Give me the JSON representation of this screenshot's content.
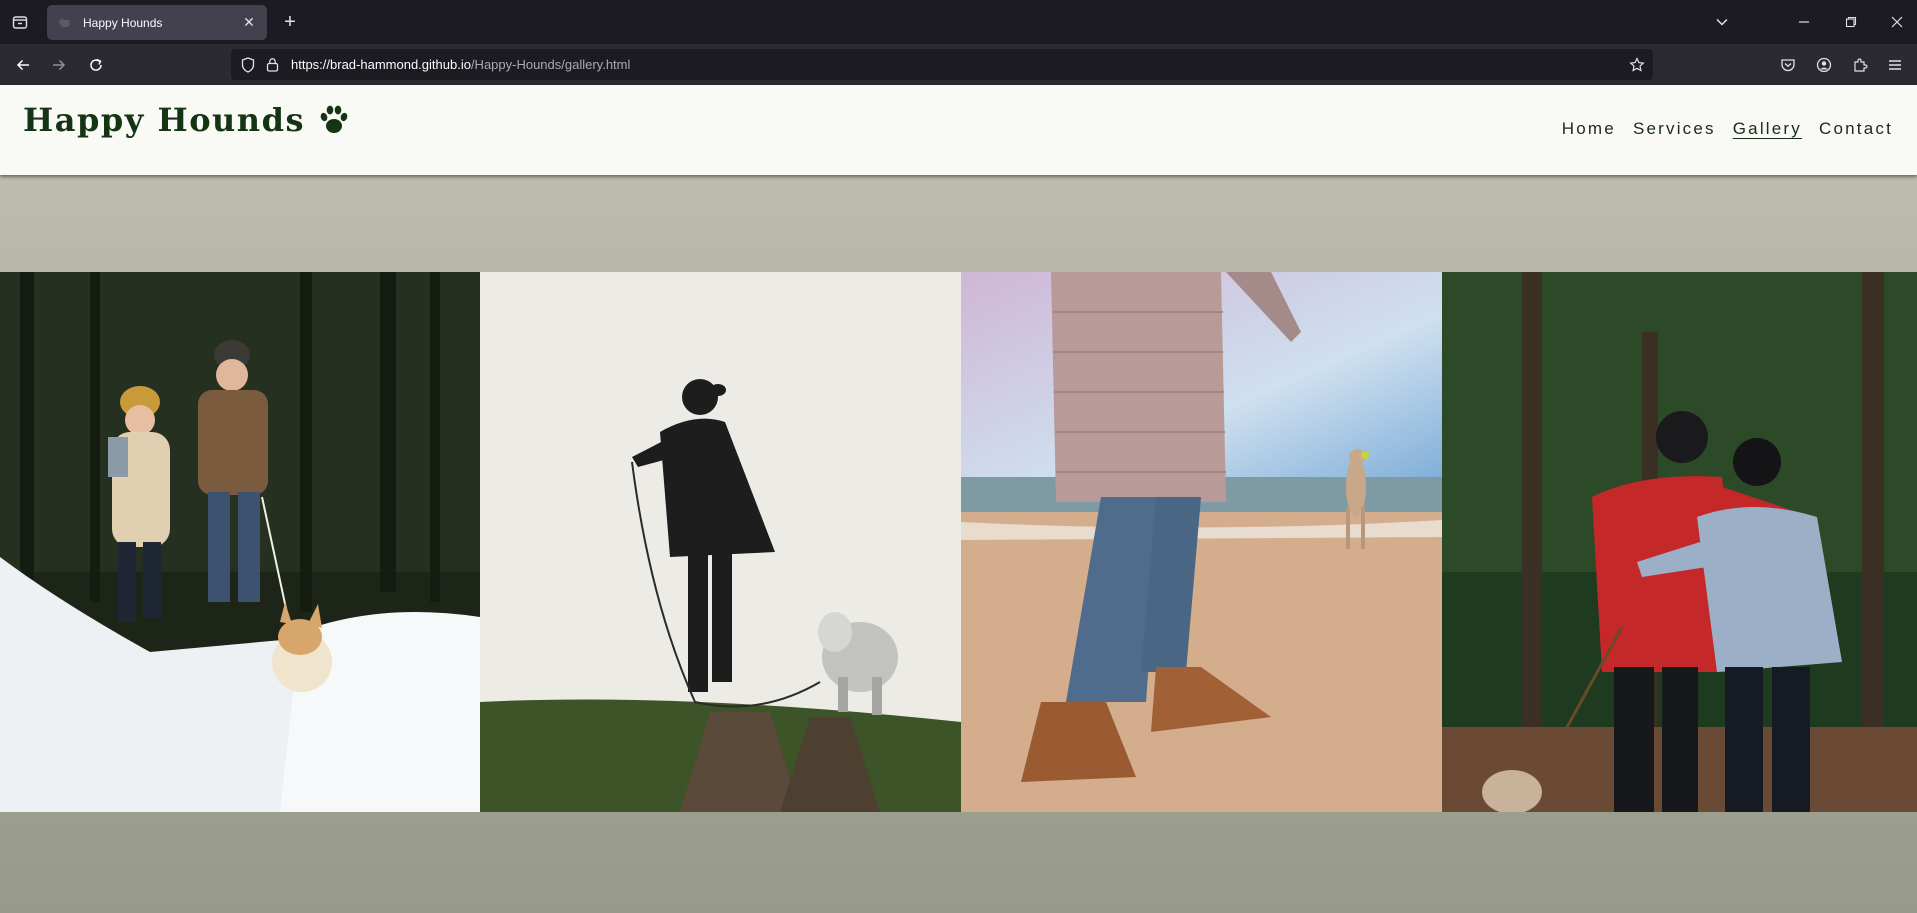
{
  "browser": {
    "tab": {
      "title": "Happy Hounds"
    },
    "url": {
      "host": "https://brad-hammond.github.io",
      "path": "/Happy-Hounds/gallery.html"
    }
  },
  "site": {
    "logo_text": "Happy Hounds",
    "nav": [
      {
        "label": "Home",
        "active": false
      },
      {
        "label": "Services",
        "active": false
      },
      {
        "label": "Gallery",
        "active": true
      },
      {
        "label": "Contact",
        "active": false
      }
    ]
  },
  "gallery": {
    "photos": [
      {
        "subject": "couple-walking-corgi-in-snow"
      },
      {
        "subject": "silhouette-walking-white-dog"
      },
      {
        "subject": "person-and-dog-on-beach"
      },
      {
        "subject": "couple-walking-small-dog-in-park"
      }
    ]
  },
  "colors": {
    "header_bg": "#f9f9f5",
    "logo": "#143414",
    "page_bg": "#bdbcae"
  }
}
